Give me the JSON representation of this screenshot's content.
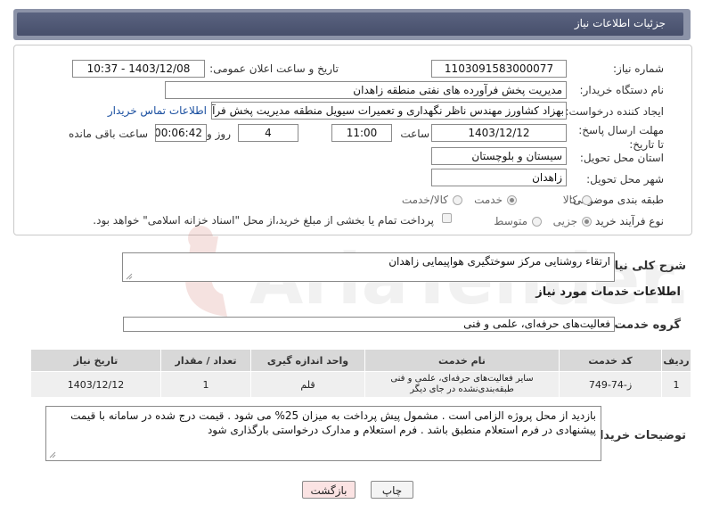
{
  "header": {
    "title": "جزئیات اطلاعات نیاز"
  },
  "form": {
    "need_number": {
      "label": "شماره نیاز:",
      "value": "1103091583000077"
    },
    "announce_datetime": {
      "label": "تاریخ و ساعت اعلان عمومی:",
      "value": "1403/12/08 - 10:37"
    },
    "buyer_org": {
      "label": "نام دستگاه خریدار:",
      "value": "مدیریت پخش فرآورده های نفتی منطقه زاهدان"
    },
    "requester": {
      "label": "ایجاد کننده درخواست:",
      "value": "بهزاد کشاورز مهندس ناظر نگهداری و تعمیرات سیویل منطقه  مدیریت پخش فرآور",
      "contact_link": "اطلاعات تماس خریدار"
    },
    "deadline": {
      "label": "مهلت ارسال پاسخ: تا تاریخ:",
      "date": "1403/12/12",
      "time_label": "ساعت",
      "time": "11:00",
      "days": "4",
      "days_label": "روز و",
      "remaining": "00:06:42",
      "remaining_label": "ساعت باقی مانده"
    },
    "province": {
      "label": "استان محل تحویل:",
      "value": "سیستان و بلوچستان"
    },
    "city": {
      "label": "شهر محل تحویل:",
      "value": "زاهدان"
    },
    "category": {
      "label": "طبقه بندی موضوعی:",
      "options": [
        "کالا",
        "خدمت",
        "کالا/خدمت"
      ],
      "selected": "خدمت"
    },
    "purchase_type": {
      "label": "نوع فرآیند خرید :",
      "options": [
        "جزیی",
        "متوسط"
      ],
      "selected": "جزیی",
      "payment_note": "پرداخت تمام یا بخشی از مبلغ خرید،از محل \"اسناد خزانه اسلامی\" خواهد بود."
    }
  },
  "summary": {
    "label": "شرح کلی نیاز:",
    "value": "ارتقاء روشنایی مرکز سوختگیری هواپیمایی زاهدان"
  },
  "services_section": {
    "title": "اطلاعات خدمات مورد نیاز"
  },
  "service_group": {
    "label": "گروه خدمت:",
    "value": "فعالیت‌های حرفه‌ای، علمی و فنی"
  },
  "table": {
    "headers": [
      "ردیف",
      "کد خدمت",
      "نام خدمت",
      "واحد اندازه گیری",
      "تعداد / مقدار",
      "تاریخ نیاز"
    ],
    "rows": [
      [
        "1",
        "ز-74-749",
        "سایر فعالیت‌های حرفه‌ای، علمی و فنی طبقه‌بندی‌نشده در جای دیگر",
        "قلم",
        "1",
        "1403/12/12"
      ]
    ]
  },
  "buyer_notes": {
    "label": "توضیحات خریدار:",
    "value": "بازدید از محل پروژه الزامی است . مشمول پیش پرداخت به میزان 25% می شود . قیمت درج شده در سامانه با قیمت پیشنهادی  در فرم استعلام منطبق باشد . فرم استعلام و مدارک درخواستی بارگذاری شود"
  },
  "buttons": {
    "print": "چاپ",
    "back": "بازگشت"
  },
  "watermark": {
    "text": "AriaTender.neT"
  },
  "colors": {
    "header_bg": "#4f5874",
    "link": "#1a4fa0",
    "back_btn_bg": "#fbe3e3"
  }
}
